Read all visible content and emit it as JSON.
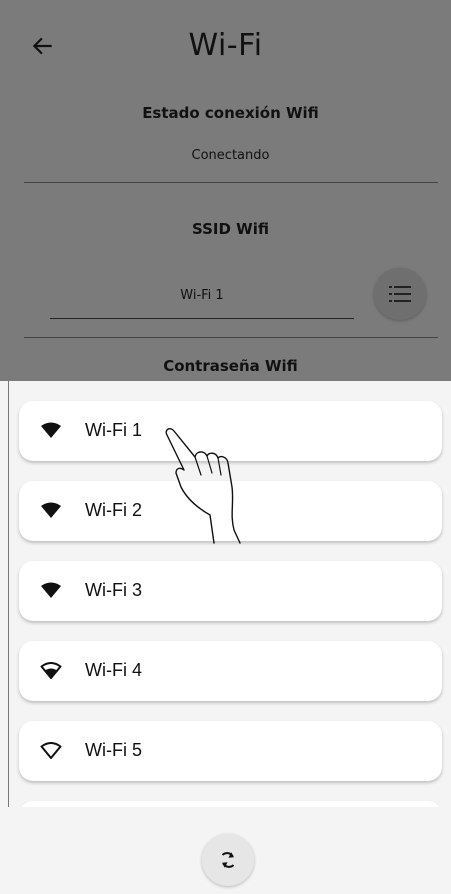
{
  "header": {
    "title": "Wi-Fi",
    "back_icon": "arrow-left-icon"
  },
  "connection": {
    "label": "Estado conexión Wifi",
    "value": "Conectando"
  },
  "ssid": {
    "label": "SSID Wifi",
    "value": "Wi-Fi 1",
    "list_icon": "list-icon"
  },
  "password": {
    "label": "Contraseña Wifi"
  },
  "networks": [
    {
      "name": "Wi-Fi 1",
      "icon": "wifi-filled-icon"
    },
    {
      "name": "Wi-Fi 2",
      "icon": "wifi-filled-icon"
    },
    {
      "name": "Wi-Fi 3",
      "icon": "wifi-filled-icon"
    },
    {
      "name": "Wi-Fi 4",
      "icon": "wifi-medium-icon"
    },
    {
      "name": "Wi-Fi 5",
      "icon": "wifi-outline-icon"
    }
  ],
  "footer": {
    "refresh_icon": "refresh-icon"
  },
  "colors": {
    "overlay": "#7b7b7b",
    "sheet": "#f4f4f4",
    "card": "#ffffff",
    "text": "#111111"
  }
}
